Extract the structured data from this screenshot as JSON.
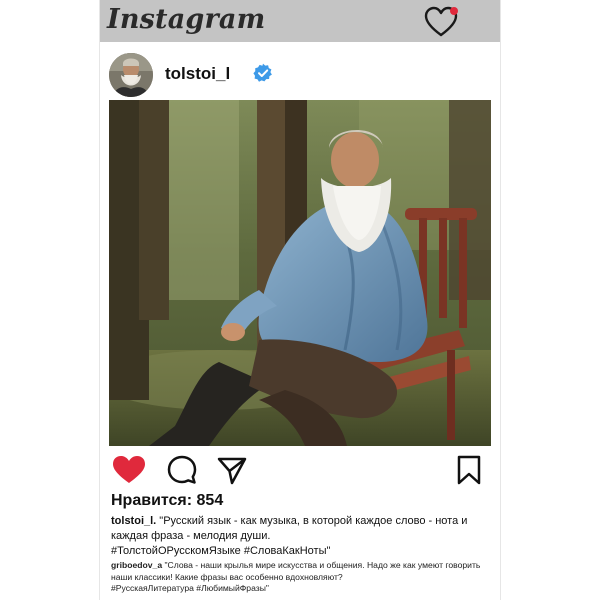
{
  "app": {
    "name": "Instagram"
  },
  "colors": {
    "header_bg": "#c4c4c4",
    "like_red": "#e0293c",
    "verified_blue": "#3d9ae8"
  },
  "header": {
    "logo": "Instagram",
    "icons": [
      "heart-outline-icon",
      "notification-dot"
    ]
  },
  "post": {
    "username": "tolstoi_l",
    "verified": true,
    "image": "Portrait photo of an elderly bearded man in a blue shirt seated on a wooden garden bench among trees",
    "actions": [
      "heart-filled-icon",
      "comment-icon",
      "share-icon",
      "bookmark-icon"
    ],
    "likes_label": "Нравится: 854",
    "caption": {
      "author": "tolstoi_l.",
      "text": " \"Русский язык - как музыка, в которой каждое слово - нота и каждая фраза - мелодия души.",
      "hashtags": "#ТолстойОРусскомЯзыке #СловаКакНоты\""
    },
    "comment": {
      "author": "griboedov_a",
      "text": " \"Слова - наши крылья мире искусства и общения. Надо же как умеют говорить наши классики! Какие фразы вас особенно вдохновляют?",
      "hashtags": "#РусскаяЛитература #ЛюбимыйФразы\""
    }
  }
}
